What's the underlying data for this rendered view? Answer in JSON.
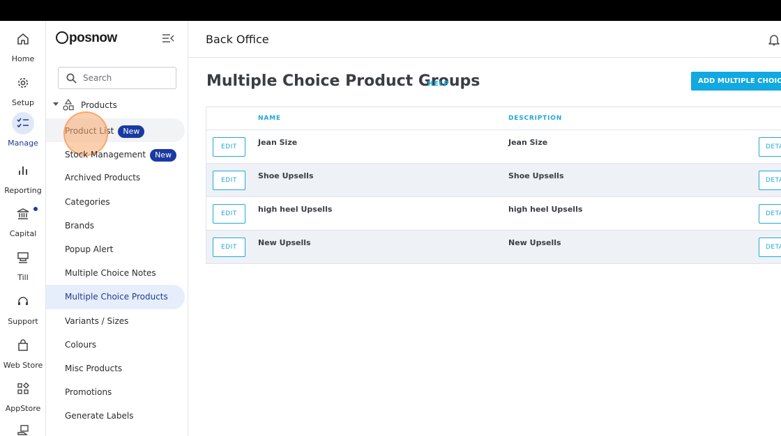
{
  "rail": {
    "items": [
      {
        "label": "Home",
        "icon": "home-icon"
      },
      {
        "label": "Setup",
        "icon": "gear-icon"
      },
      {
        "label": "Manage",
        "icon": "checklist-icon",
        "active": true
      },
      {
        "label": "Reporting",
        "icon": "bar-chart-icon"
      },
      {
        "label": "Capital",
        "icon": "bank-icon",
        "has_notification": true
      },
      {
        "label": "Till",
        "icon": "till-icon"
      },
      {
        "label": "Support",
        "icon": "headset-icon"
      },
      {
        "label": "Web Store",
        "icon": "shopping-bag-icon"
      },
      {
        "label": "AppStore",
        "icon": "app-grid-icon"
      }
    ]
  },
  "sidebar": {
    "logo": "posnow",
    "search": {
      "placeholder": "Search",
      "value": ""
    },
    "section": "Products",
    "items": [
      {
        "label": "Product List",
        "badge": "New"
      },
      {
        "label": "Stock Management",
        "badge": "New"
      },
      {
        "label": "Archived Products"
      },
      {
        "label": "Categories"
      },
      {
        "label": "Brands"
      },
      {
        "label": "Popup Alert"
      },
      {
        "label": "Multiple Choice Notes"
      },
      {
        "label": "Multiple Choice Products",
        "active": true
      },
      {
        "label": "Variants / Sizes"
      },
      {
        "label": "Colours"
      },
      {
        "label": "Misc Products"
      },
      {
        "label": "Promotions"
      },
      {
        "label": "Generate Labels"
      }
    ]
  },
  "header": {
    "title": "Back Office"
  },
  "main": {
    "page_title": "Multiple Choice Product Groups",
    "help_label": "HELP",
    "add_button_label": "ADD MULTIPLE CHOICE PI",
    "table": {
      "columns": [
        "NAME",
        "DESCRIPTION"
      ],
      "edit_label": "EDIT",
      "detail_label": "DETA",
      "rows": [
        {
          "name": "Jean Size",
          "description": "Jean Size"
        },
        {
          "name": "Shoe Upsells",
          "description": "Shoe Upsells"
        },
        {
          "name": "high heel Upsells",
          "description": "high heel Upsells"
        },
        {
          "name": "New Upsells",
          "description": "New Upsells"
        }
      ]
    }
  },
  "colors": {
    "accent": "#20a8d8",
    "brand_badge": "#1a3aa3",
    "active_nav": "#1f3a93"
  }
}
